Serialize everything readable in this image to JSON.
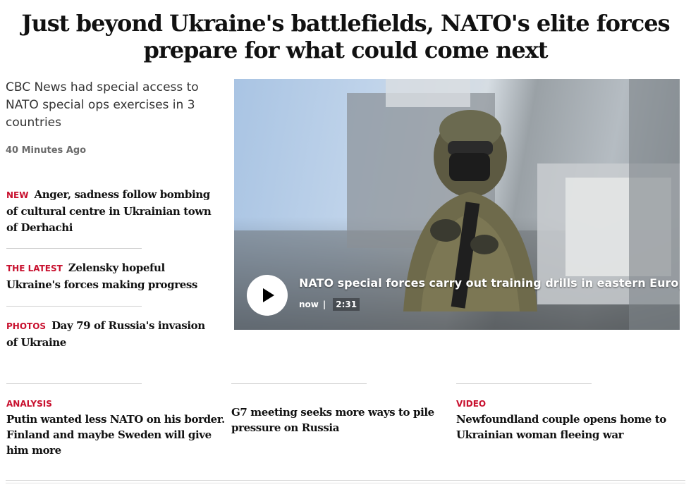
{
  "headline": "Just beyond Ukraine's battlefields, NATO's elite forces prepare for what could come next",
  "dek": "CBC News had special access to NATO special ops exercises in 3 countries",
  "timestamp": "40 Minutes Ago",
  "side_items": [
    {
      "label": "NEW",
      "text": "Anger, sadness follow bombing of cultural centre in Ukrainian town of Derhachi"
    },
    {
      "label": "THE LATEST",
      "text": "Zelensky hopeful Ukraine's forces making progress"
    },
    {
      "label": "PHOTOS",
      "text": "Day 79 of Russia's invasion of Ukraine"
    }
  ],
  "video": {
    "title": "NATO special forces carry out training drills in eastern Europe",
    "time": "now",
    "separator": "|",
    "duration": "2:31",
    "play_icon": "play-icon"
  },
  "bottom_row": [
    {
      "category": "ANALYSIS",
      "title": "Putin wanted less NATO on his border. Finland and maybe Sweden will give him more"
    },
    {
      "category": "",
      "title": "G7 meeting seeks more ways to pile pressure on Russia"
    },
    {
      "category": "VIDEO",
      "title": "Newfoundland couple opens home to Ukrainian woman fleeing war"
    }
  ],
  "colors": {
    "accent": "#c8102e",
    "text": "#111111",
    "muted": "#6b6b6b"
  }
}
